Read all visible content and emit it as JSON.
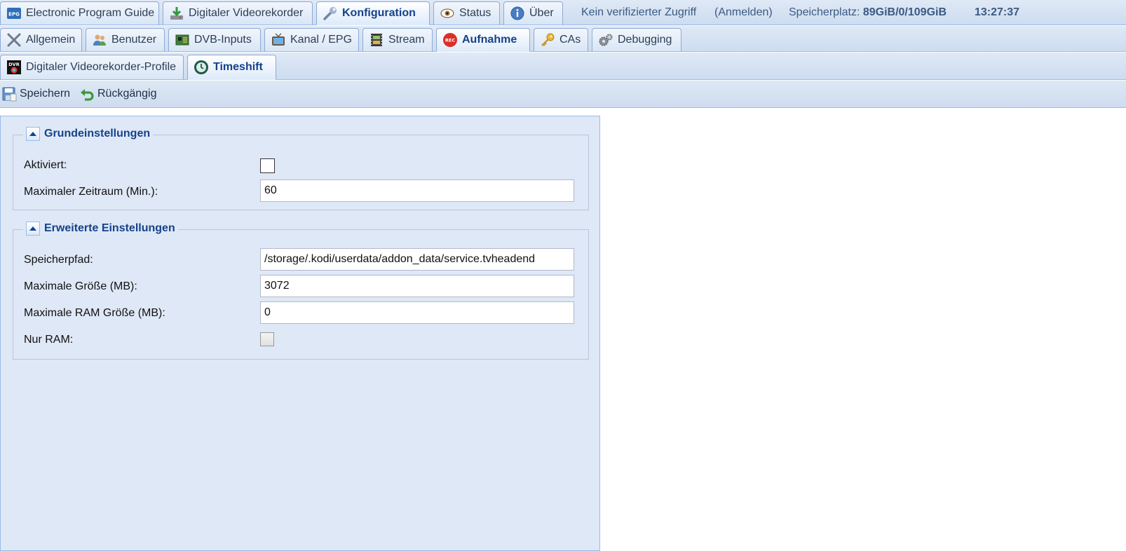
{
  "main_tabs": [
    {
      "label": "Electronic Program Guide",
      "icon": "epg-icon"
    },
    {
      "label": "Digitaler Videorekorder",
      "icon": "download-icon"
    },
    {
      "label": "Konfiguration",
      "icon": "wrench-icon",
      "active": true
    },
    {
      "label": "Status",
      "icon": "eye-icon"
    },
    {
      "label": "Über",
      "icon": "info-icon"
    }
  ],
  "status": {
    "access": "Kein verifizierter Zugriff",
    "login": "(Anmelden)",
    "storage_label": "Speicherplatz:",
    "storage_value": "89GiB/0/109GiB",
    "time": "13:27:37"
  },
  "config_tabs": [
    {
      "label": "Allgemein",
      "icon": "tools-icon"
    },
    {
      "label": "Benutzer",
      "icon": "users-icon"
    },
    {
      "label": "DVB-Inputs",
      "icon": "card-icon"
    },
    {
      "label": "Kanal / EPG",
      "icon": "tv-icon"
    },
    {
      "label": "Stream",
      "icon": "film-icon"
    },
    {
      "label": "Aufnahme",
      "icon": "rec-icon",
      "active": true
    },
    {
      "label": "CAs",
      "icon": "key-icon"
    },
    {
      "label": "Debugging",
      "icon": "gears-icon"
    }
  ],
  "recording_tabs": [
    {
      "label": "Digitaler Videorekorder-Profile",
      "icon": "dvr-icon"
    },
    {
      "label": "Timeshift",
      "icon": "clock-icon",
      "active": true
    }
  ],
  "toolbar": {
    "save_label": "Speichern",
    "undo_label": "Rückgängig"
  },
  "basic": {
    "title": "Grundeinstellungen",
    "enabled_label": "Aktiviert:",
    "enabled": false,
    "max_period_label": "Maximaler Zeitraum (Min.):",
    "max_period_value": "60"
  },
  "advanced": {
    "title": "Erweiterte Einstellungen",
    "path_label": "Speicherpfad:",
    "path_value": "/storage/.kodi/userdata/addon_data/service.tvheadend",
    "max_size_label": "Maximale Größe (MB):",
    "max_size_value": "3072",
    "max_ram_label": "Maximale RAM Größe (MB):",
    "max_ram_value": "0",
    "ram_only_label": "Nur RAM:",
    "ram_only": false
  },
  "colors": {
    "accent": "#15428b",
    "tab_border": "#99bbe8",
    "panel_bg": "#dfe8f6",
    "rec_red": "#d9302a"
  }
}
